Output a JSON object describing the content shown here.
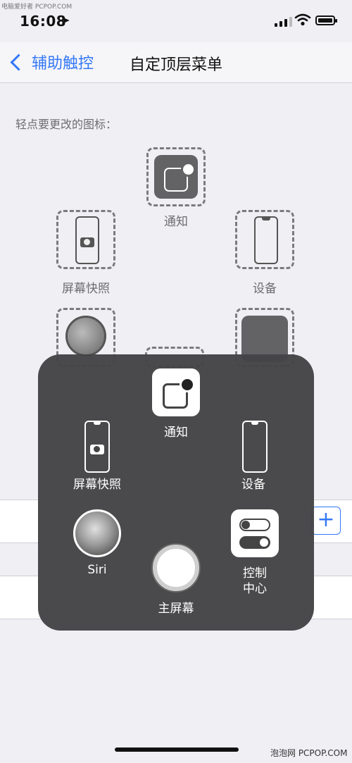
{
  "status_bar": {
    "time": "16:08",
    "location_glyph": "➤"
  },
  "watermark_top": "电脑爱好者 PCPOP.COM",
  "nav": {
    "back_label": "辅助触控",
    "title": "自定顶层菜单"
  },
  "hint": "轻点要更改的图标：",
  "bg_slots": {
    "notification": "通知",
    "screenshot": "屏幕快照",
    "device": "设备"
  },
  "menu": {
    "notification": "通知",
    "screenshot": "屏幕快照",
    "device": "设备",
    "siri": "Siri",
    "control_center_line1": "控制",
    "control_center_line2": "中心",
    "home": "主屏幕"
  },
  "plus_label": "+",
  "watermark_bottom": "泡泡网 PCPOP.COM",
  "colors": {
    "accent": "#3478f6",
    "panel": "#444446"
  }
}
